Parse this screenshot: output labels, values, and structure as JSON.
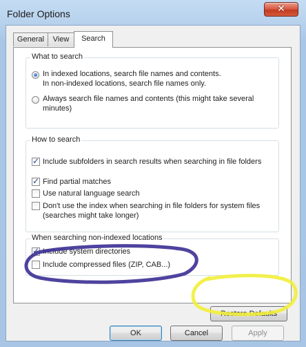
{
  "window": {
    "title": "Folder Options",
    "close_glyph": "✕"
  },
  "tabs": [
    {
      "label": "General",
      "active": false
    },
    {
      "label": "View",
      "active": false
    },
    {
      "label": "Search",
      "active": true
    }
  ],
  "what_to_search": {
    "heading": "What to search",
    "options": [
      {
        "line1": "In indexed locations, search file names and contents.",
        "line2": "In non-indexed locations, search file names only.",
        "selected": true
      },
      {
        "line1": "Always search file names and contents (this might take several",
        "line2": "minutes)",
        "selected": false
      }
    ]
  },
  "how_to_search": {
    "heading": "How to search",
    "options": [
      {
        "line1": "Include subfolders in search results when searching in file folders",
        "line2": "",
        "checked": true
      },
      {
        "line1": "Find partial matches",
        "line2": "",
        "checked": true
      },
      {
        "line1": "Use natural language search",
        "line2": "",
        "checked": false
      },
      {
        "line1": "Don't use the index when searching in file folders for system files",
        "line2": "(searches might take longer)",
        "checked": false
      }
    ]
  },
  "non_indexed": {
    "heading": "When searching non-indexed locations",
    "options": [
      {
        "label": "Include system directories",
        "checked": true
      },
      {
        "label": "Include compressed files (ZIP, CAB...)",
        "checked": false
      }
    ]
  },
  "buttons": {
    "restore_defaults": "Restore Defaults",
    "ok": "OK",
    "cancel": "Cancel",
    "apply": "Apply"
  },
  "annotations": {
    "purple_marker": "#3b2f93",
    "yellow_marker": "#f2ee3a"
  }
}
